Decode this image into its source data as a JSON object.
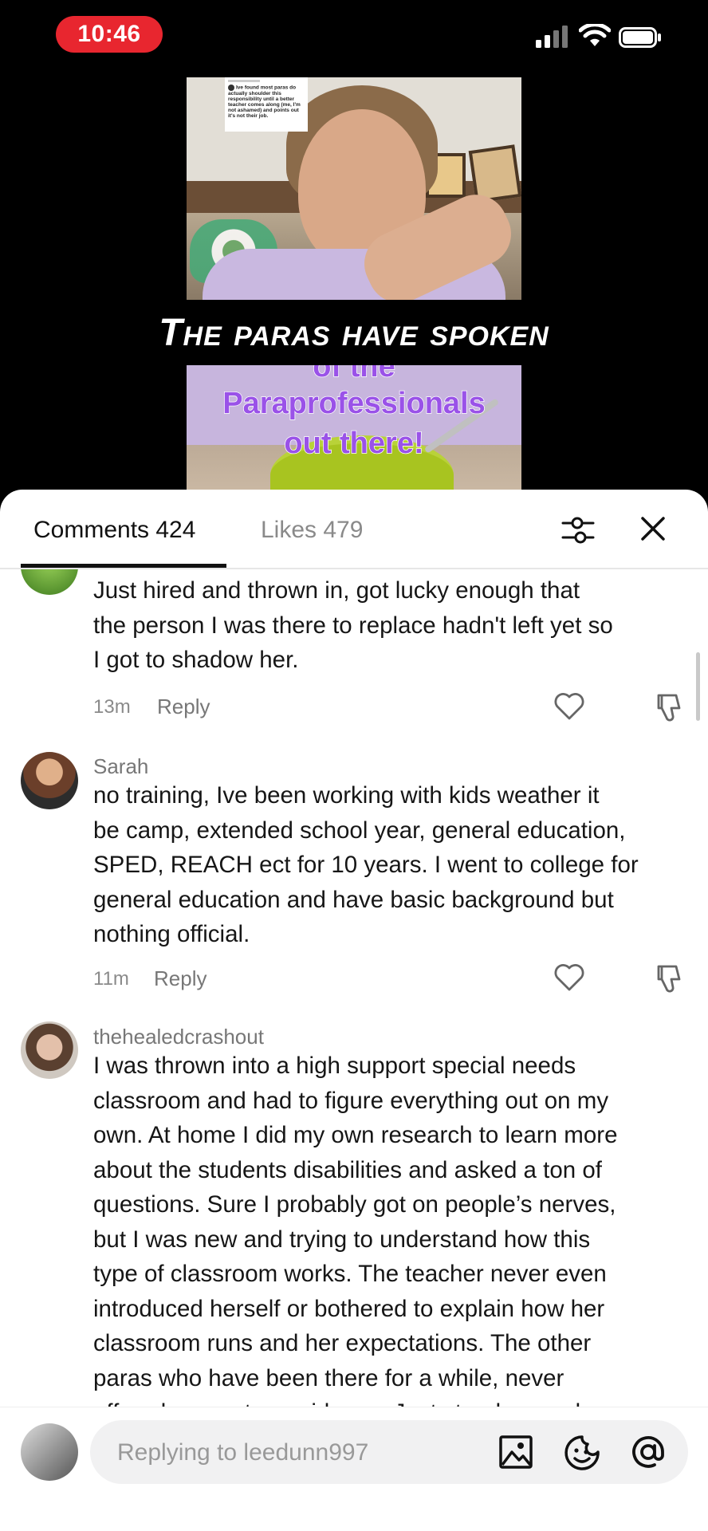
{
  "status": {
    "time": "10:46",
    "icons": [
      "signal-icon",
      "wifi-icon",
      "battery-icon"
    ]
  },
  "video": {
    "overlay_title": "The paras have spoken",
    "caption_card": "Ive found most paras do actually shoulder this responsibility until a better teacher comes along (me, I'm not ashamed) and points out it's not their job.",
    "overlay_text": [
      "of the",
      "Paraprofessionals",
      "out there!"
    ]
  },
  "tabs": {
    "comments": "Comments 424",
    "likes": "Likes 479"
  },
  "comments": [
    {
      "username": "",
      "lines": [
        "Just hired and thrown in, got lucky enough that",
        "the person I was there to replace hadn't left yet so",
        "I got to shadow her."
      ],
      "time": "13m",
      "reply": "Reply"
    },
    {
      "username": "Sarah",
      "lines": [
        "no training, Ive been working with kids weather it",
        "be camp, extended school year, general education,",
        "SPED, REACH ect for 10 years. I went to college for",
        "general education and have basic background but",
        "nothing official."
      ],
      "time": "11m",
      "reply": "Reply"
    },
    {
      "username": "thehealedcrashout",
      "lines": [
        "I was thrown into a high support special needs",
        "classroom and had to figure everything out on my",
        "own. At home I did my own research to learn more",
        "about the students disabilities and asked a ton of",
        "questions. Sure I probably got on people’s nerves,",
        "but I was new and trying to understand how this",
        "type of classroom works. The teacher never even",
        "introduced herself or bothered to explain how her",
        "classroom runs and her expectations. The other",
        "paras who have been there for a while, never",
        "offered support or guidance. Just stood around"
      ]
    }
  ],
  "composer": {
    "placeholder": "Replying to leedunn997",
    "icons": [
      "image-icon",
      "emoji-icon",
      "at-mention-icon"
    ]
  },
  "colors": {
    "time_pill": "#e8262f",
    "overlay_purple": "#9a52e8",
    "text_primary": "#161616",
    "text_secondary": "#8a8a8a"
  }
}
